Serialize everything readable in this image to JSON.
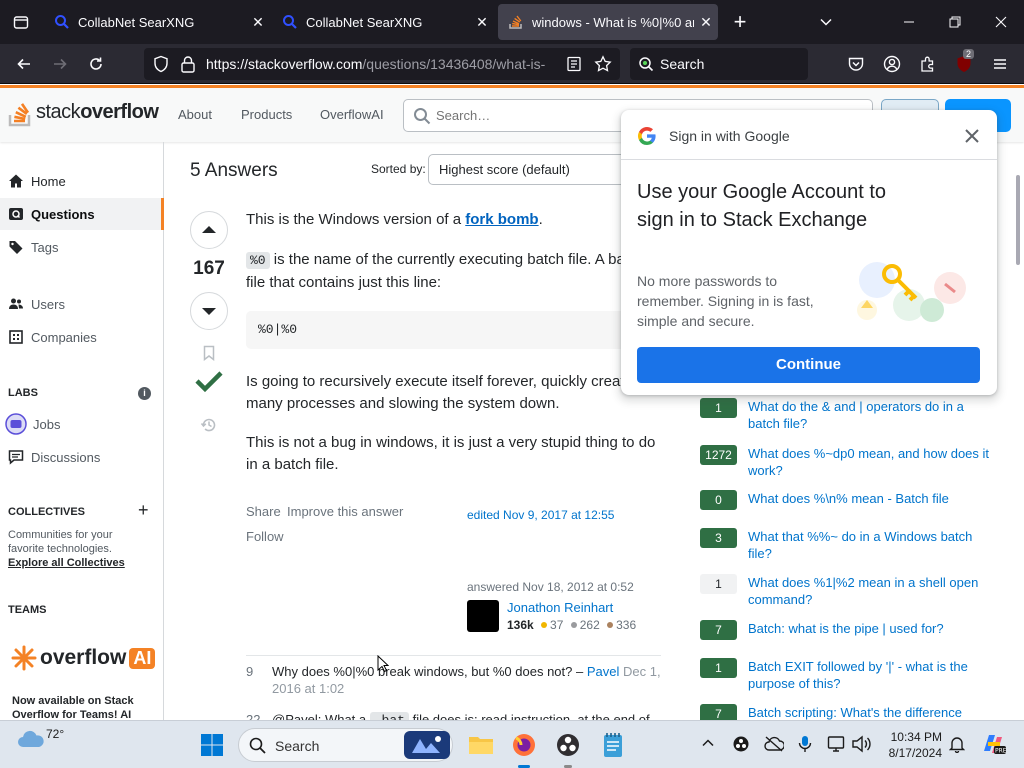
{
  "browser": {
    "tabs": [
      {
        "label": "CollabNet SearXNG"
      },
      {
        "label": "CollabNet SearXNG"
      },
      {
        "label": "windows - What is %0|%0 and h"
      }
    ],
    "url": {
      "main": "https://stackoverflow.com",
      "rest": "/questions/13436408/what-is-"
    },
    "search_label": "Search",
    "extension_badge": "2"
  },
  "so_header": {
    "logo_text_a": "stack",
    "logo_text_b": "overflow",
    "nav": [
      "About",
      "Products",
      "OverflowAI"
    ],
    "search_placeholder": "Search…"
  },
  "left_nav": {
    "items": [
      "Home",
      "Questions",
      "Tags",
      "Users",
      "Companies"
    ],
    "labs_heading": "LABS",
    "labs_items": [
      "Jobs",
      "Discussions"
    ],
    "collectives_heading": "COLLECTIVES",
    "collectives_text": "Communities for your favorite technologies.",
    "collectives_link": "Explore all Collectives",
    "teams_heading": "TEAMS",
    "teams_logo_a": "overflow",
    "teams_logo_b": "AI",
    "teams_text": "Now available on Stack Overflow for Teams! AI"
  },
  "answers": {
    "heading": "5 Answers",
    "sorted_by": "Sorted by:",
    "sort_value": "Highest score (default)"
  },
  "answer": {
    "votes": "167",
    "p1_before": "This is the Windows version of a ",
    "p1_link": "fork bomb",
    "p1_after": ".",
    "p2_code": "%0",
    "p2_text": " is the name of the currently executing batch file. A ba",
    "p2_line2": "file that contains just this line:",
    "code": "%0|%0",
    "p3_line1": "Is going to recursively execute itself forever, quickly creat",
    "p3_line2": "many processes and slowing the system down.",
    "p4_line1": "This is not a bug in windows, it is just a very stupid thing to do",
    "p4_line2": "in a batch file.",
    "menu_share": "Share",
    "menu_improve": "Improve this answer",
    "menu_follow": "Follow",
    "edited": "edited Nov 9, 2017 at 12:55",
    "answered": "answered Nov 18, 2012 at 0:52",
    "user": "Jonathon Reinhart",
    "rep": "136k",
    "gold": "37",
    "silver": "262",
    "bronze": "336"
  },
  "comments": [
    {
      "score": "9",
      "text": "Why does %0|%0 break windows, but %0 does not? – ",
      "user": "Pavel",
      "date": "Dec 1, 2016 at 1:02"
    },
    {
      "score": "22",
      "text_before": "@Pavel: What a ",
      "code": ".bat",
      "text_after": " file does is: read instruction, at the end of"
    }
  ],
  "popup": {
    "title": "Sign in with Google",
    "heading": "Use your Google Account to sign in to Stack Exchange",
    "subtext": "No more passwords to remember. Signing in is fast, simple and secure.",
    "button": "Continue"
  },
  "related": [
    {
      "count": "1",
      "style": "green",
      "text": "What do the & and | operators do in a batch file?"
    },
    {
      "count": "1272",
      "style": "green",
      "text": "What does %~dp0 mean, and how does it work?"
    },
    {
      "count": "0",
      "style": "green",
      "text": "What does %\\n% mean - Batch file"
    },
    {
      "count": "3",
      "style": "green",
      "text": "What that %%~ do in a Windows batch file?"
    },
    {
      "count": "1",
      "style": "grey",
      "text": "What does %1|%2 mean in a shell open command?"
    },
    {
      "count": "7",
      "style": "green",
      "text": "Batch: what is the pipe | used for?"
    },
    {
      "count": "1",
      "style": "green",
      "text": "Batch EXIT followed by '|' - what is the purpose of this?"
    },
    {
      "count": "7",
      "style": "green",
      "text": "Batch scripting: What's the difference"
    }
  ],
  "taskbar": {
    "weather": "72°",
    "search": "Search",
    "time": "10:34 PM",
    "date": "8/17/2024"
  }
}
